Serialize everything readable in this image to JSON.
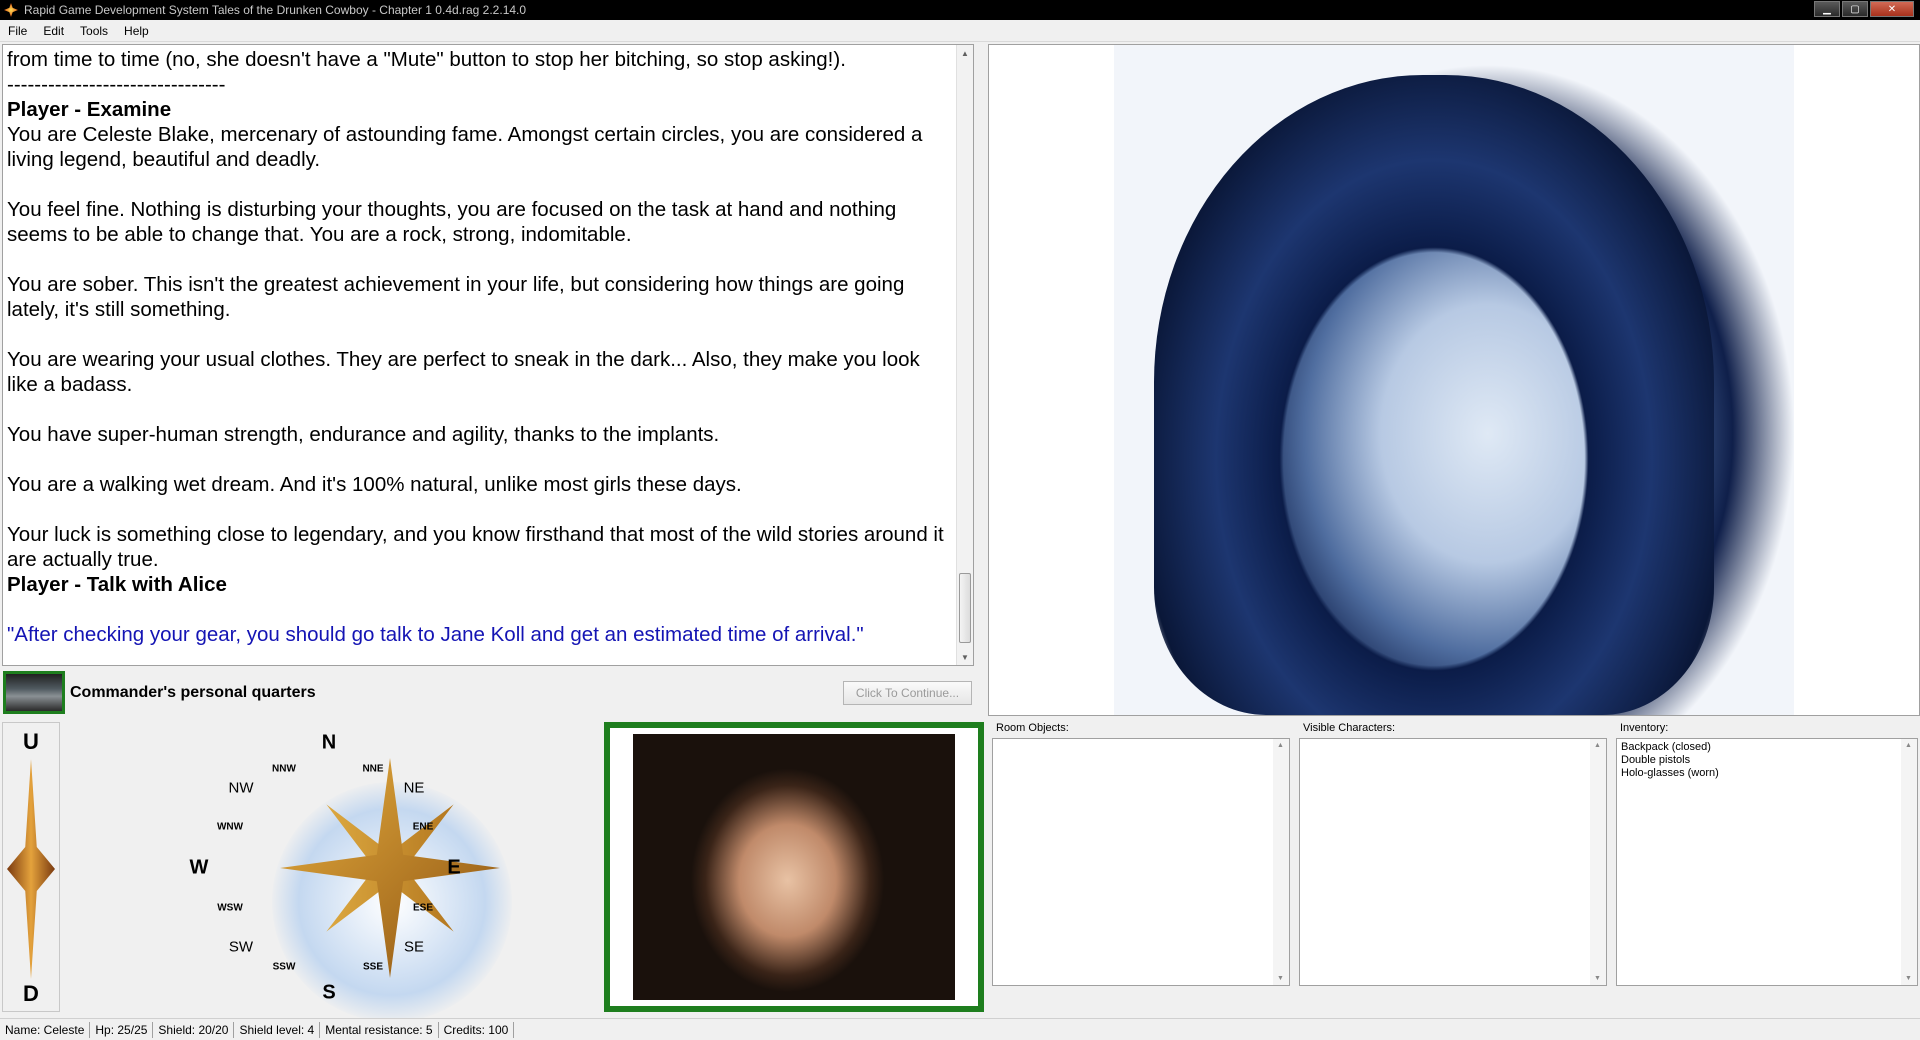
{
  "window": {
    "title": "Rapid Game Development System Tales of the Drunken Cowboy - Chapter 1 0.4d.rag 2.2.14.0"
  },
  "menu": [
    "File",
    "Edit",
    "Tools",
    "Help"
  ],
  "game_text": {
    "line_mute": "from time to time (no, she doesn't have a \"Mute\" button to stop her bitching, so stop asking!).",
    "separator": "--------------------------------",
    "heading_examine": "Player - Examine",
    "p1": "You are Celeste Blake, mercenary of astounding fame. Amongst certain circles, you are considered a living legend, beautiful and deadly.",
    "p2": "You feel fine. Nothing is disturbing your thoughts, you are focused on the task at hand and nothing seems to be able to change that. You are a rock, strong, indomitable.",
    "p3": "You are sober. This isn't the greatest achievement in your life, but considering how things are going lately, it's still something.",
    "p4": "You are wearing your usual clothes. They are perfect to sneak in the dark... Also, they make you look like a badass.",
    "p5": "You have super-human strength, endurance and agility, thanks to the implants.",
    "p6": "You are a walking wet dream. And it's 100% natural, unlike most girls these days.",
    "p7": "Your luck is something close to legendary, and you know firsthand that most of the wild stories around it are actually true.",
    "heading_talk": "Player - Talk with Alice",
    "speech": "\"After checking your gear, you should go talk to Jane Koll and get an estimated time of arrival.\""
  },
  "location": {
    "name": "Commander's personal quarters",
    "continue_label": "Click To Continue..."
  },
  "compass": {
    "up": "U",
    "down": "D",
    "N": "N",
    "S": "S",
    "E": "E",
    "W": "W",
    "NE": "NE",
    "NW": "NW",
    "SE": "SE",
    "SW": "SW",
    "NNE": "NNE",
    "NNW": "NNW",
    "ENE": "ENE",
    "ESE": "ESE",
    "SSE": "SSE",
    "SSW": "SSW",
    "WSW": "WSW",
    "WNW": "WNW",
    "accent": "#1e7e1e"
  },
  "panels": {
    "room_objects_label": "Room Objects:",
    "visible_characters_label": "Visible Characters:",
    "inventory_label": "Inventory:",
    "inventory": [
      "Backpack (closed)",
      "Double pistols",
      "Holo-glasses (worn)"
    ]
  },
  "status": {
    "name": "Name: Celeste",
    "hp": "Hp: 25/25",
    "shield": "Shield: 20/20",
    "shield_level": "Shield level: 4",
    "mental": "Mental resistance: 5",
    "credits": "Credits: 100"
  }
}
